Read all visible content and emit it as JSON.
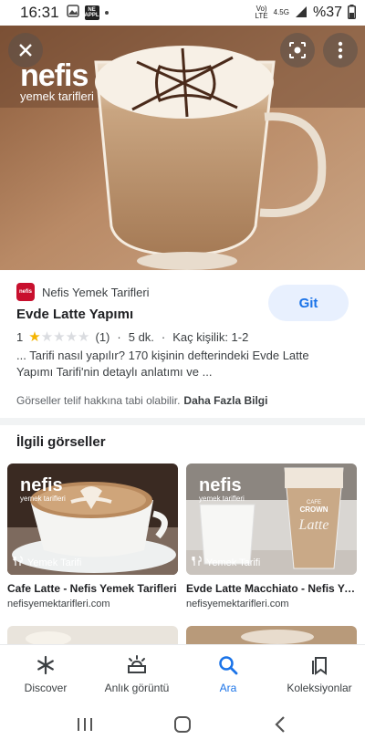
{
  "status_bar": {
    "time": "16:31",
    "app_badge": "NE APPL",
    "network_top": "Vo)",
    "network_bottom": "LTE",
    "signal_label": "4.5G",
    "battery": "%37"
  },
  "hero": {
    "watermark_brand": "nefis",
    "watermark_sub": "yemek tarifleri",
    "close_icon": "close-icon",
    "lens_icon": "lens-icon",
    "more_icon": "more-vert-icon"
  },
  "result": {
    "source_logo_text": "nefis",
    "source_name": "Nefis Yemek Tarifleri",
    "visit_button": "Git",
    "title": "Evde Latte Yapımı",
    "rating_value": "1",
    "rating_stars": 1,
    "rating_max": 5,
    "rating_count": "(1)",
    "separator": "·",
    "duration": "5 dk.",
    "servings": "Kaç kişilik: 1-2",
    "description": "... Tarifi nasıl yapılır? 170 kişinin defterindeki Evde Latte Yapımı Tarifi'nin detaylı anlatımı ve ...",
    "copyright": "Görseller telif hakkına tabi olabilir.",
    "more_info": "Daha Fazla Bilgi"
  },
  "related": {
    "title": "İlgili görseller",
    "items": [
      {
        "tag": "Yemek Tarifi",
        "title": "Cafe Latte - Nefis Yemek Tarifleri",
        "domain": "nefisyemektarifleri.com",
        "watermark": "nefis",
        "watermark_sub": "yemek tarifleri"
      },
      {
        "tag": "Yemek Tarifi",
        "title": "Evde Latte Macchiato - Nefis Yemek Tarifleri",
        "domain": "nefisyemektarifleri.com",
        "watermark": "nefis",
        "watermark_sub": "yemek tarifleri",
        "label_top": "CAFE",
        "label_mid": "CROWN",
        "label_script": "Latte"
      }
    ]
  },
  "bottom_nav": {
    "items": [
      {
        "label": "Discover",
        "icon": "asterisk-icon"
      },
      {
        "label": "Anlık görüntü",
        "icon": "snapshot-icon"
      },
      {
        "label": "Ara",
        "icon": "search-icon",
        "active": true
      },
      {
        "label": "Koleksiyonlar",
        "icon": "collections-icon"
      }
    ]
  },
  "colors": {
    "accent": "#1a73e8",
    "accent_bg": "#e8f0fe",
    "star": "#f4b400",
    "brand_red": "#c8102e"
  }
}
